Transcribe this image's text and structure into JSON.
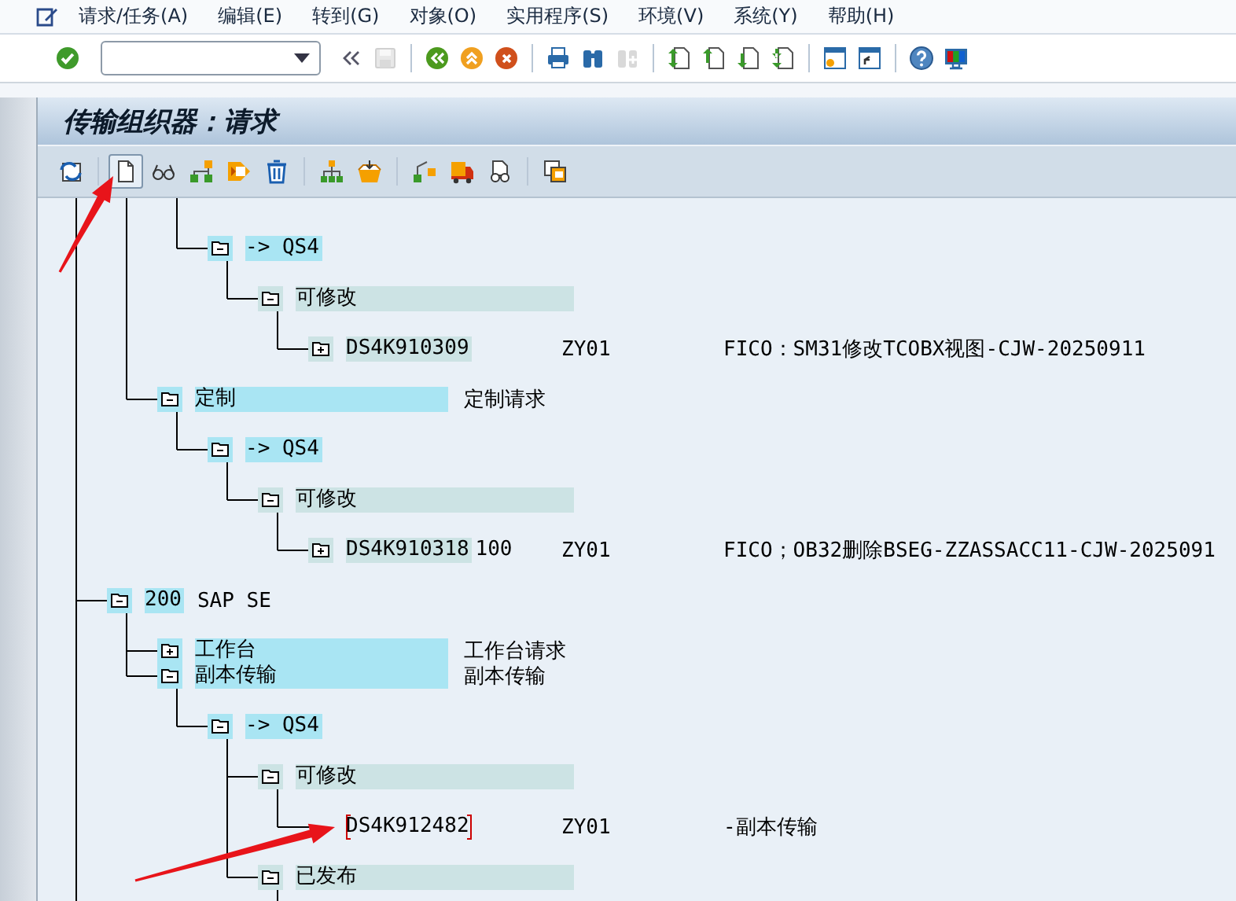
{
  "menu": [
    {
      "label": "请求/任务(A)"
    },
    {
      "label": "编辑(E)"
    },
    {
      "label": "转到(G)"
    },
    {
      "label": "对象(O)"
    },
    {
      "label": "实用程序(S)"
    },
    {
      "label": "环境(V)"
    },
    {
      "label": "系统(Y)"
    },
    {
      "label": "帮助(H)"
    }
  ],
  "system_toolbar": {
    "buttons": [
      {
        "disabled": false
      },
      {
        "disabled": false
      },
      {
        "disabled": true
      },
      {
        "disabled": false
      },
      {
        "disabled": false
      },
      {
        "disabled": false
      },
      {
        "disabled": false
      },
      {
        "disabled": false
      },
      {
        "disabled": true
      },
      {
        "disabled": false
      },
      {
        "disabled": false
      },
      {
        "disabled": false
      },
      {
        "disabled": false
      },
      {
        "disabled": false
      },
      {
        "disabled": false
      },
      {
        "disabled": false
      },
      {
        "disabled": false
      }
    ]
  },
  "title": "传输组织器：请求",
  "app_toolbar": {
    "buttons": [
      {
        "pressed": false
      },
      {
        "pressed": true
      },
      {
        "pressed": false
      },
      {
        "pressed": false
      },
      {
        "pressed": false
      },
      {
        "pressed": false
      },
      {
        "pressed": false
      },
      {
        "pressed": false
      },
      {
        "pressed": false
      },
      {
        "pressed": false
      },
      {
        "pressed": false
      },
      {
        "pressed": false
      }
    ]
  },
  "tree": {
    "nodes": [
      {
        "children": [
          {
            "children": [
              {
                "kind": "target",
                "label": "-> QS4",
                "expanded": true,
                "children": [
                  {
                    "kind": "status",
                    "label": "可修改",
                    "expanded": true,
                    "children": [
                      {
                        "kind": "request",
                        "id": "DS4K910309",
                        "expanded": false,
                        "selected": false,
                        "owner": "ZY01",
                        "text": "FICO：SM31修改TCOBX视图-CJW-20250911"
                      }
                    ]
                  }
                ]
              }
            ]
          },
          {
            "kind": "category",
            "label": "定制",
            "description": "定制请求",
            "expanded": true,
            "children": [
              {
                "kind": "target",
                "label": "-> QS4",
                "expanded": true,
                "children": [
                  {
                    "kind": "status",
                    "label": "可修改",
                    "expanded": true,
                    "children": [
                      {
                        "kind": "request",
                        "id": "DS4K910318",
                        "client": "100",
                        "expanded": false,
                        "selected": false,
                        "owner": "ZY01",
                        "text": "FICO；OB32删除BSEG-ZZASSACC11-CJW-2025091"
                      }
                    ]
                  }
                ]
              }
            ]
          }
        ]
      },
      {
        "kind": "client",
        "number": "200",
        "name": "SAP SE",
        "expanded": true,
        "children": [
          {
            "kind": "category",
            "label": "工作台",
            "description": "工作台请求",
            "expanded": false
          },
          {
            "kind": "category",
            "label": "副本传输",
            "description": "副本传输",
            "expanded": true,
            "children": [
              {
                "kind": "target",
                "label": "-> QS4",
                "expanded": true,
                "children": [
                  {
                    "kind": "status",
                    "label": "可修改",
                    "expanded": true,
                    "children": [
                      {
                        "kind": "request",
                        "id": "DS4K912482",
                        "selected": true,
                        "owner": "ZY01",
                        "text": "-副本传输"
                      }
                    ]
                  },
                  {
                    "kind": "status",
                    "label": "已发布",
                    "expanded": true
                  }
                ]
              }
            ]
          }
        ]
      }
    ]
  }
}
